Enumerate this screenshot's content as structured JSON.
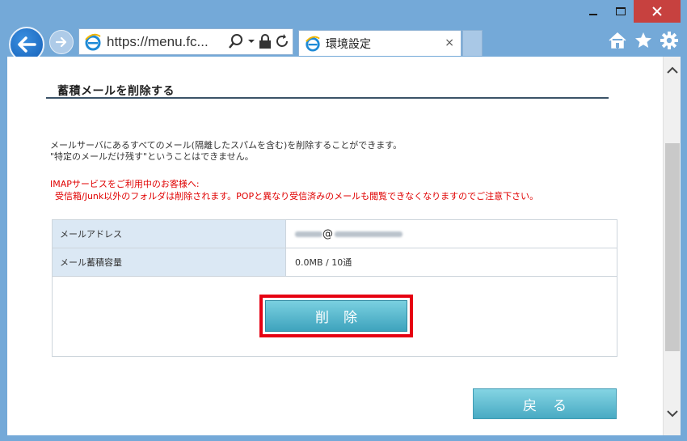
{
  "browser": {
    "url": "https://menu.fc...",
    "tab_title": "環境設定",
    "tab_close": "×",
    "icons": [
      "back-arrow-icon",
      "forward-arrow-icon",
      "ie-logo-icon",
      "search-icon",
      "dropdown-icon",
      "lock-icon",
      "refresh-icon",
      "home-icon",
      "favorites-star-icon",
      "settings-gear-icon"
    ]
  },
  "page": {
    "heading": "蓄積メールを削除する",
    "description": [
      "メールサーバにあるすべてのメール(隔離したスパムを含む)を削除することができます。",
      "\"特定のメールだけ残す\"ということはできません。"
    ],
    "warning": [
      "IMAPサービスをご利用中のお客様へ:",
      "受信箱/Junk以外のフォルダは削除されます。POPと異なり受信済みのメールも閲覧できなくなりますのでご注意下さい。"
    ],
    "table": [
      {
        "label": "メールアドレス",
        "value_at": "@"
      },
      {
        "label": "メール蓄積容量",
        "value": "0.0MB / 10通"
      }
    ],
    "delete_button": "削除",
    "back_button": "戻る"
  },
  "colors": {
    "frame": "#74a9d8",
    "close": "#c7413f",
    "warning_text": "#e00000",
    "button": "#48aac3",
    "highlight": "#e60012"
  }
}
